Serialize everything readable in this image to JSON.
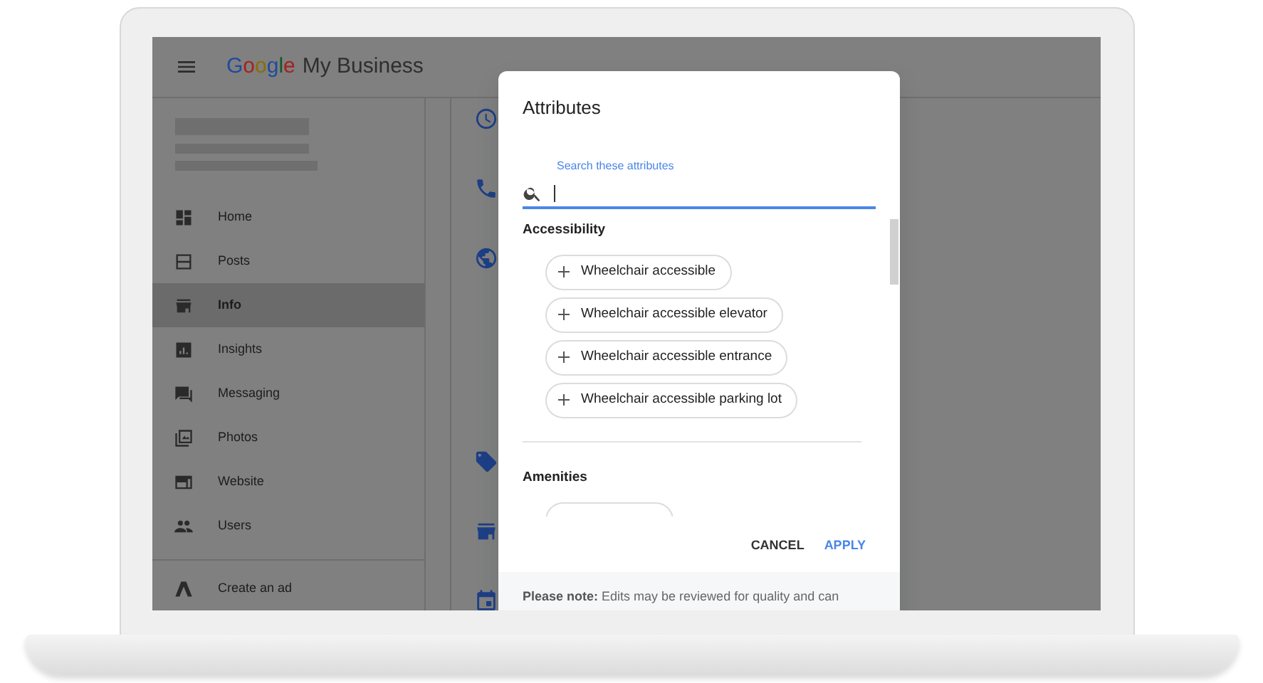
{
  "header": {
    "logo": "Google",
    "product": "My Business"
  },
  "sidebar": {
    "items": [
      {
        "label": "Home",
        "selected": false
      },
      {
        "label": "Posts",
        "selected": false
      },
      {
        "label": "Info",
        "selected": true
      },
      {
        "label": "Insights",
        "selected": false
      },
      {
        "label": "Messaging",
        "selected": false
      },
      {
        "label": "Photos",
        "selected": false
      },
      {
        "label": "Website",
        "selected": false
      },
      {
        "label": "Users",
        "selected": false
      }
    ],
    "footer_item": "Create an ad"
  },
  "dialog": {
    "title": "Attributes",
    "search": {
      "label": "Search these attributes"
    },
    "sections": [
      {
        "title": "Accessibility",
        "chips": [
          "Wheelchair accessible",
          "Wheelchair accessible elevator",
          "Wheelchair accessible entrance",
          "Wheelchair accessible parking lot"
        ]
      },
      {
        "title": "Amenities",
        "cut_off": true
      }
    ],
    "buttons": [
      {
        "label": "CANCEL",
        "kind": "text"
      },
      {
        "label": "APPLY",
        "kind": "primary"
      }
    ],
    "note": "**Please note:** Edits may be reviewed for quality and can"
  }
}
